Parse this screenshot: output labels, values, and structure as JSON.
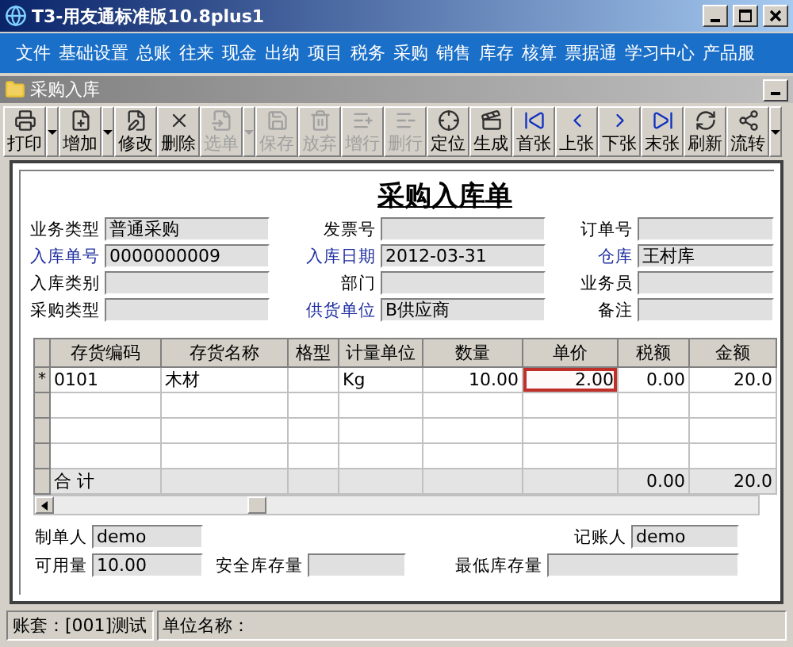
{
  "window": {
    "title": "T3-用友通标准版10.8plus1"
  },
  "menu": [
    "文件",
    "基础设置",
    "总账",
    "往来",
    "现金",
    "出纳",
    "项目",
    "税务",
    "采购",
    "销售",
    "库存",
    "核算",
    "票据通",
    "学习中心",
    "产品服"
  ],
  "child_window": {
    "title": "采购入库"
  },
  "toolbar": [
    {
      "label": "打印",
      "disabled": false,
      "dropdown": true
    },
    {
      "label": "增加",
      "disabled": false,
      "dropdown": true
    },
    {
      "label": "修改",
      "disabled": false,
      "dropdown": false
    },
    {
      "label": "删除",
      "disabled": false,
      "dropdown": false
    },
    {
      "label": "选单",
      "disabled": true,
      "dropdown": true
    },
    {
      "label": "保存",
      "disabled": true,
      "dropdown": false
    },
    {
      "label": "放弃",
      "disabled": true,
      "dropdown": false
    },
    {
      "label": "增行",
      "disabled": true,
      "dropdown": false
    },
    {
      "label": "删行",
      "disabled": true,
      "dropdown": false
    },
    {
      "label": "定位",
      "disabled": false,
      "dropdown": false
    },
    {
      "label": "生成",
      "disabled": false,
      "dropdown": false
    },
    {
      "label": "首张",
      "disabled": false,
      "dropdown": false
    },
    {
      "label": "上张",
      "disabled": false,
      "dropdown": false
    },
    {
      "label": "下张",
      "disabled": false,
      "dropdown": false
    },
    {
      "label": "末张",
      "disabled": false,
      "dropdown": false
    },
    {
      "label": "刷新",
      "disabled": false,
      "dropdown": false
    },
    {
      "label": "流转",
      "disabled": false,
      "dropdown": true
    }
  ],
  "form": {
    "title": "采购入库单",
    "fields": [
      {
        "label": "业务类型",
        "value": "普通采购",
        "required": false
      },
      {
        "label": "发票号",
        "required": false
      },
      {
        "label": "订单号",
        "required": false
      },
      {
        "label": "入库单号",
        "value": "0000000009",
        "required": true
      },
      {
        "label": "入库日期",
        "value": "2012-03-31",
        "required": true
      },
      {
        "label": "仓库",
        "value": "王村库",
        "required": true
      },
      {
        "label": "入库类别",
        "required": false
      },
      {
        "label": "部门",
        "required": false
      },
      {
        "label": "业务员",
        "required": false
      },
      {
        "label": "采购类型",
        "required": false
      },
      {
        "label": "供货单位",
        "value": "B供应商",
        "required": true
      },
      {
        "label": "备注",
        "required": false
      }
    ]
  },
  "table": {
    "columns": [
      "存货编码",
      "存货名称",
      "格型",
      "计量单位",
      "数量",
      "单价",
      "税额",
      "金额"
    ],
    "rows": [
      {
        "marker": "*",
        "cells": [
          {
            "text": "0101",
            "selected": false
          },
          {
            "text": "木材",
            "selected": false
          },
          {
            "selected": false
          },
          {
            "text": "Kg",
            "selected": false
          },
          {
            "text": "10.00",
            "selected": false
          },
          {
            "text": "2.00",
            "selected": true
          },
          {
            "text": "0.00",
            "selected": false
          },
          {
            "text": "20.0",
            "selected": false
          }
        ]
      }
    ],
    "totals": {
      "label": "合 计",
      "tax": "0.00",
      "amount": "20.0"
    }
  },
  "footer_fields": [
    {
      "label": "制单人",
      "value": "demo"
    },
    {
      "label": "记账人",
      "value": "demo"
    },
    {
      "label": "可用量",
      "value": "10.00"
    },
    {
      "label": "安全库存量"
    },
    {
      "label": "最低库存量"
    }
  ],
  "status_bar": [
    "账套：[001]测试",
    "单位名称："
  ]
}
